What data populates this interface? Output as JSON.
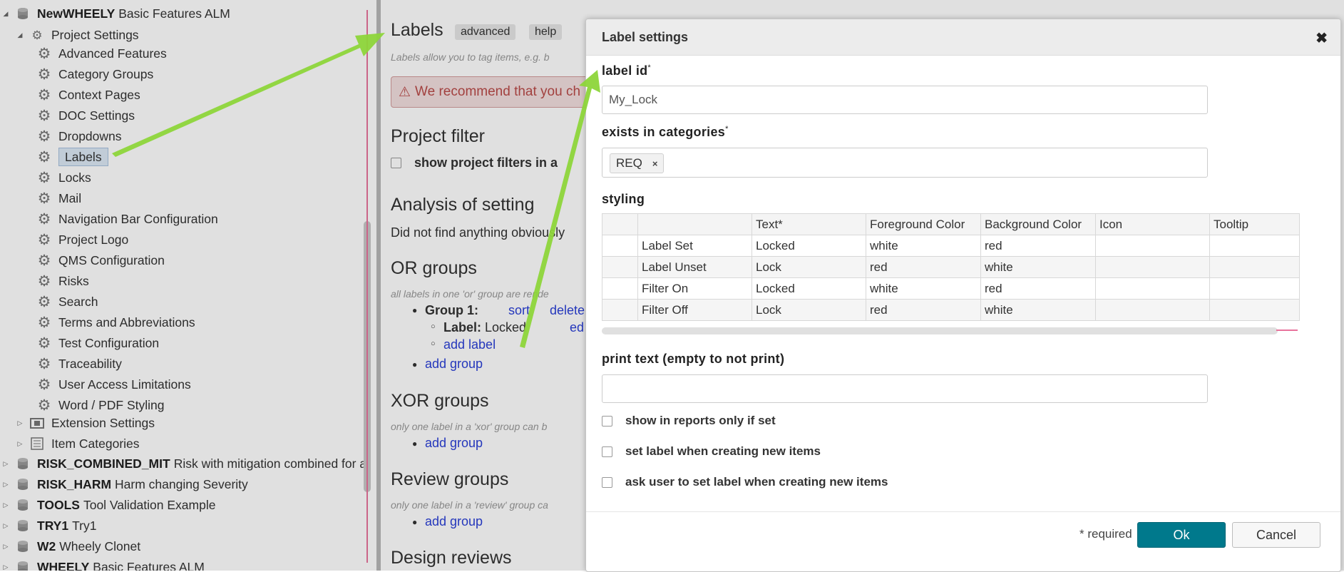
{
  "tree": {
    "root": {
      "code": "NewWHEELY",
      "name": "Basic Features ALM"
    },
    "project_settings": "Project Settings",
    "settings_items": [
      "Advanced Features",
      "Category Groups",
      "Context Pages",
      "DOC Settings",
      "Dropdowns",
      "Labels",
      "Locks",
      "Mail",
      "Navigation Bar Configuration",
      "Project Logo",
      "QMS Configuration",
      "Risks",
      "Search",
      "Terms and Abbreviations",
      "Test Configuration",
      "Traceability",
      "User Access Limitations",
      "Word / PDF Styling"
    ],
    "extension_settings": "Extension Settings",
    "item_categories": "Item Categories",
    "projects": [
      {
        "code": "RISK_COMBINED_MIT",
        "name": "Risk with mitigation combined for a"
      },
      {
        "code": "RISK_HARM",
        "name": "Harm changing Severity"
      },
      {
        "code": "TOOLS",
        "name": "Tool Validation Example"
      },
      {
        "code": "TRY1",
        "name": "Try1"
      },
      {
        "code": "W2",
        "name": "Wheely Clonet"
      },
      {
        "code": "WHEELY",
        "name": "Basic Features ALM"
      }
    ]
  },
  "main": {
    "title": "Labels",
    "advanced_tag": "advanced",
    "help_tag": "help",
    "subtitle": "Labels allow you to tag items, e.g. b",
    "alert": "We recommend that you ch",
    "project_filter_title": "Project filter",
    "project_filter_checkbox": "show project filters in a",
    "analysis_title": "Analysis of setting",
    "analysis_text": "Did not find anything obviously",
    "or_title": "OR groups",
    "or_note": "all labels in one 'or' group are rende",
    "group1_label": "Group 1:",
    "sort_link": "sort",
    "delete_link": "delete",
    "label_key": "Label:",
    "label_value": "Locked",
    "edit_link": "ed",
    "add_label": "add label",
    "add_group": "add group",
    "xor_title": "XOR groups",
    "xor_note": "only one label in a 'xor' group can b",
    "review_title": "Review groups",
    "review_note": "only one label in a 'review' group ca",
    "design_title": "Design reviews"
  },
  "dialog": {
    "title": "Label settings",
    "close_glyph": "✖",
    "label_id_label": "label id",
    "required_mark": "*",
    "label_id_value": "My_Lock",
    "categories_label": "exists in categories",
    "category_chip": "REQ",
    "chip_remove": "×",
    "styling_label": "styling",
    "styling_headers": [
      "",
      "",
      "Text*",
      "Foreground Color",
      "Background Color",
      "Icon",
      "Tooltip"
    ],
    "styling_rows": [
      {
        "name": "Label Set",
        "text": "Locked",
        "fg": "white",
        "bg": "red",
        "icon": "",
        "tooltip": ""
      },
      {
        "name": "Label Unset",
        "text": "Lock",
        "fg": "red",
        "bg": "white",
        "icon": "",
        "tooltip": ""
      },
      {
        "name": "Filter On",
        "text": "Locked",
        "fg": "white",
        "bg": "red",
        "icon": "",
        "tooltip": ""
      },
      {
        "name": "Filter Off",
        "text": "Lock",
        "fg": "red",
        "bg": "white",
        "icon": "",
        "tooltip": ""
      }
    ],
    "print_text_label": "print text (empty to not print)",
    "print_text_value": "",
    "checkboxes": [
      "show in reports only if set",
      "set label when creating new items",
      "ask user to set label when creating new items"
    ],
    "required_note": "* required",
    "ok_label": "Ok",
    "cancel_label": "Cancel"
  },
  "colors": {
    "ok_button": "#00798c",
    "arrow": "#8dd53a",
    "alert_text": "#b94a48",
    "link": "#2a3fd6",
    "pink_rule": "#e8739c"
  }
}
